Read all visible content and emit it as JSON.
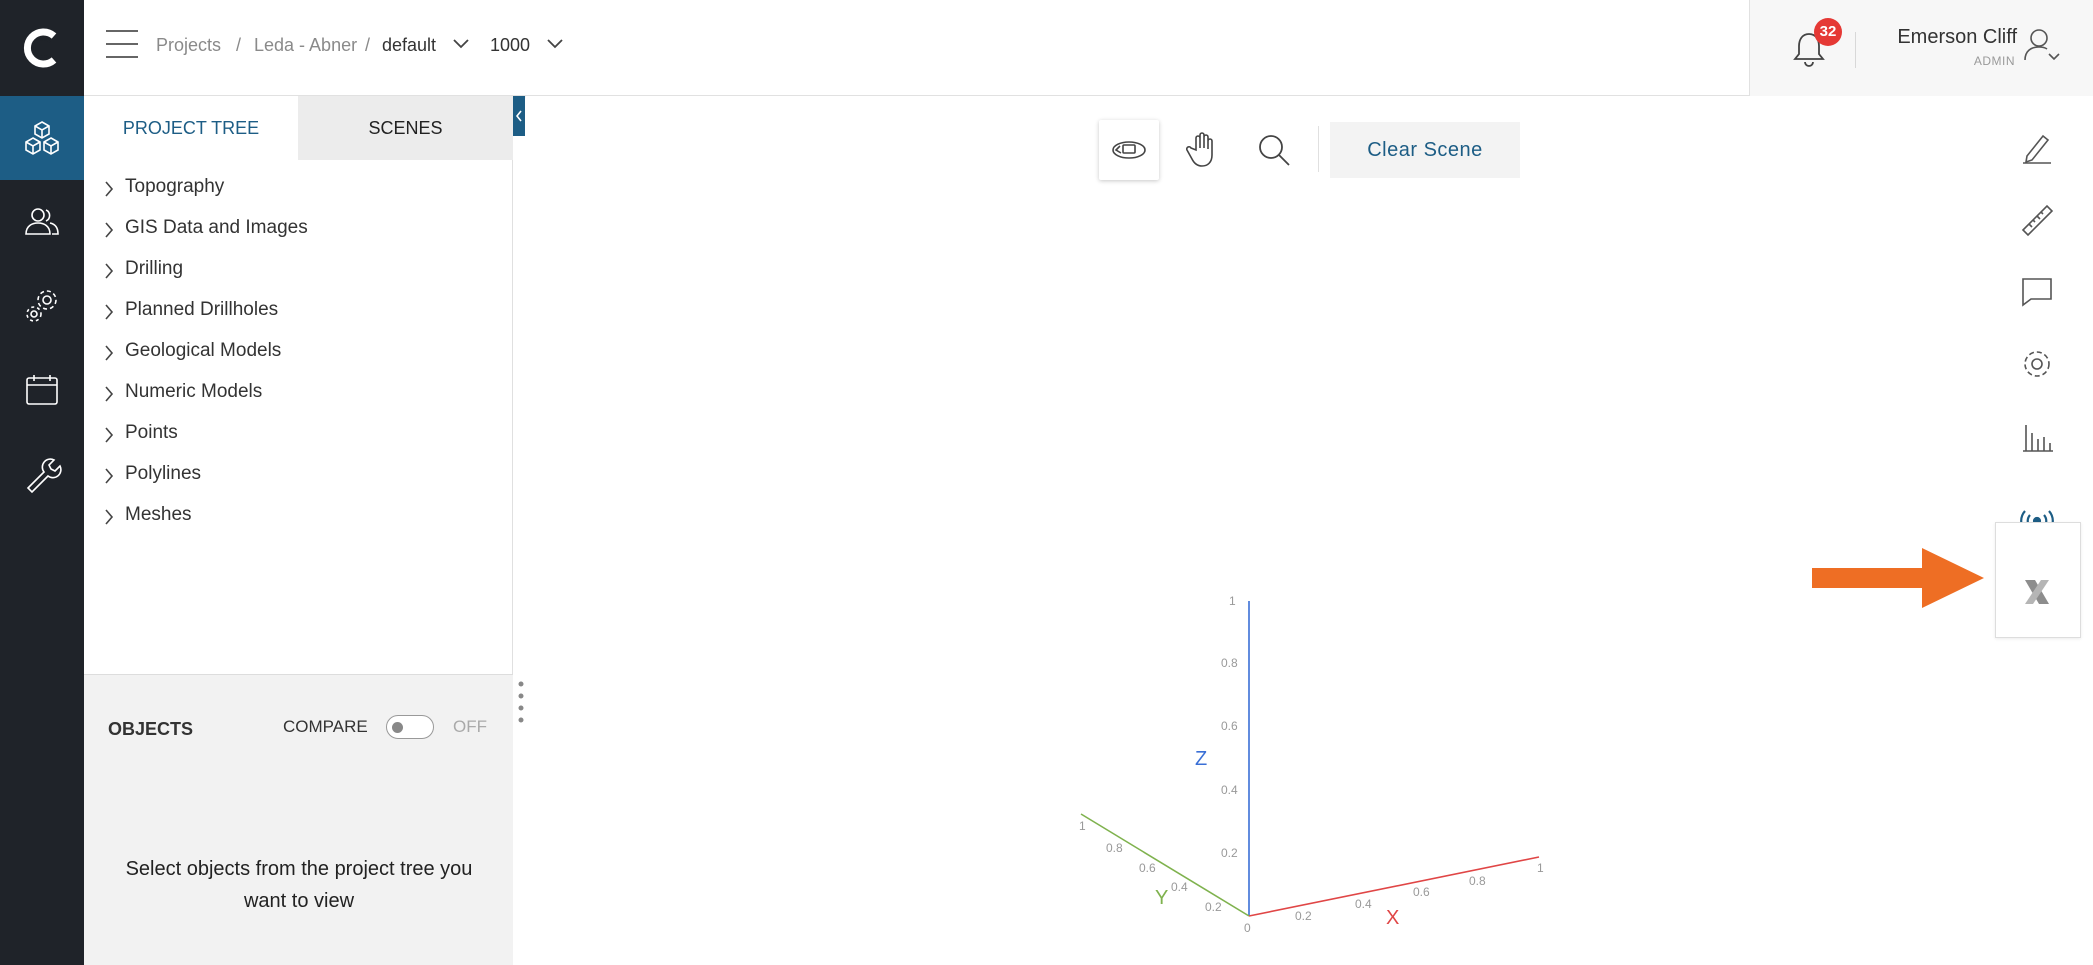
{
  "app": {
    "logo": "C"
  },
  "rail": {
    "items": [
      {
        "icon": "cubes-icon",
        "active": true
      },
      {
        "icon": "users-icon",
        "active": false
      },
      {
        "icon": "gears-icon",
        "active": false
      },
      {
        "icon": "calendar-icon",
        "active": false
      },
      {
        "icon": "wrench-icon",
        "active": false
      }
    ]
  },
  "header": {
    "breadcrumb": {
      "projects": "Projects",
      "sep1": "/",
      "project": "Leda - Abner",
      "sep2": "/",
      "scenario": "default",
      "scale": "1000"
    },
    "notifications": {
      "count": "32"
    },
    "user": {
      "name": "Emerson Cliff",
      "role": "ADMIN"
    }
  },
  "panel": {
    "tabs": {
      "tree": "PROJECT TREE",
      "scenes": "SCENES"
    },
    "tree_items": [
      "Topography",
      "GIS Data and Images",
      "Drilling",
      "Planned Drillholes",
      "Geological Models",
      "Numeric Models",
      "Points",
      "Polylines",
      "Meshes"
    ],
    "objects": {
      "title": "OBJECTS",
      "compare": "COMPARE",
      "toggle_state": "OFF",
      "message": "Select objects from the project tree you want to view"
    }
  },
  "viewport": {
    "toolbar": {
      "tools": [
        "rotate-icon",
        "pan-hand-icon",
        "zoom-icon"
      ],
      "clear_label": "Clear Scene"
    },
    "axes": {
      "z_label": "Z",
      "y_label": "Y",
      "x_label": "X",
      "z_ticks": [
        "0.2",
        "0.4",
        "0.6",
        "0.8",
        "1"
      ],
      "y_ticks": [
        "0.2",
        "0.4",
        "0.6",
        "0.8",
        "1"
      ],
      "x_ticks": [
        "0.2",
        "0.4",
        "0.6",
        "0.8",
        "1"
      ],
      "origin": "0",
      "colors": {
        "x": "#e04646",
        "y": "#7fb24e",
        "z": "#3a6fd6"
      }
    }
  },
  "right_toolbar": {
    "items": [
      "pen-icon",
      "ruler-icon",
      "comment-icon",
      "settings-icon",
      "bar-chart-icon",
      "broadcast-icon",
      "x-logo-icon"
    ]
  },
  "colors": {
    "brand": "#1d5d85",
    "rail": "#1f2329",
    "accent_arrow": "#ee6e24",
    "badge": "#e53935"
  }
}
